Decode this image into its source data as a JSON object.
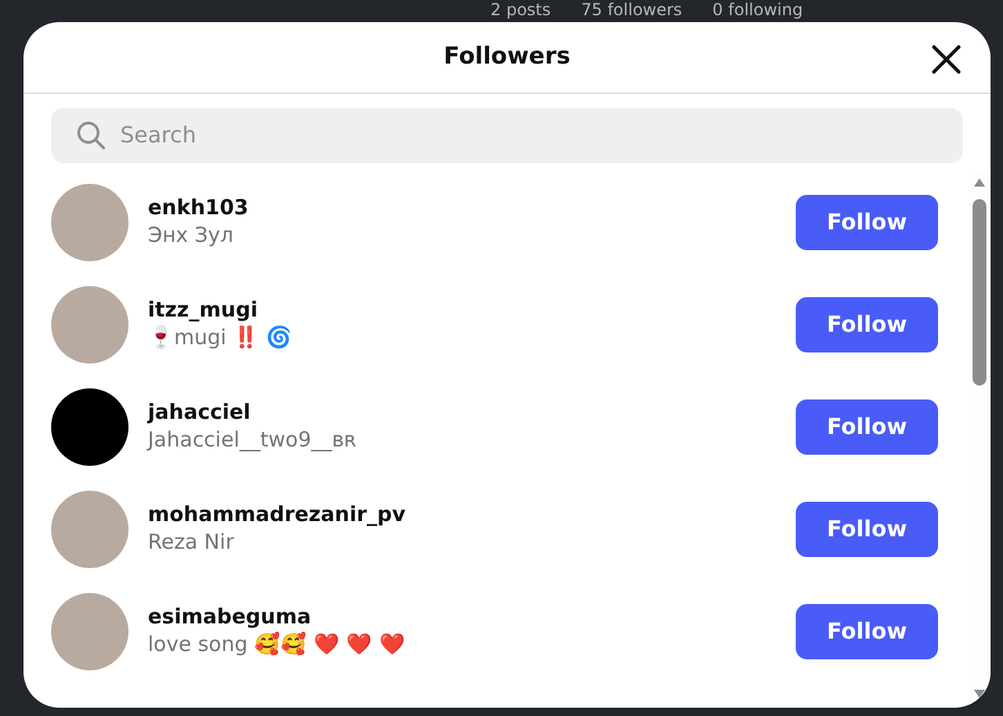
{
  "background": {
    "stats": [
      "2 posts",
      "75 followers",
      "0 following"
    ]
  },
  "dialog": {
    "title": "Followers",
    "search": {
      "placeholder": "Search"
    },
    "followers": [
      {
        "kind": "photo",
        "username": "enkh103",
        "name": "Энх Зул",
        "button": "Follow"
      },
      {
        "kind": "photo",
        "username": "itzz_mugi",
        "name": "🍷mugi ‼️ 🌀",
        "button": "Follow"
      },
      {
        "kind": "blank",
        "username": "jahacciel",
        "name": "Jahacciel__two9__ʙʀ",
        "button": "Follow"
      },
      {
        "kind": "photo",
        "username": "mohammadrezanir_pv",
        "name": "Reza Nir",
        "button": "Follow"
      },
      {
        "kind": "photo",
        "username": "esimabeguma",
        "name": "love song 🥰🥰 ❤️ ❤️ ❤️",
        "button": "Follow"
      }
    ]
  }
}
